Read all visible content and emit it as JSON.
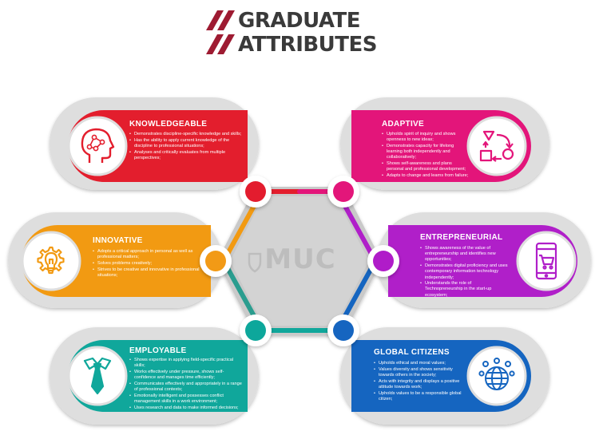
{
  "title": {
    "line1": "GRADUATE",
    "line2": "ATTRIBUTES"
  },
  "center": {
    "watermark": "MUC"
  },
  "colors": {
    "knowledgeable": "#e31e2d",
    "adaptive": "#e3157a",
    "innovative": "#f29a12",
    "entrepreneurial": "#b01fc9",
    "employable": "#10a79b",
    "global_citizens": "#1565c0"
  },
  "cards": {
    "knowledgeable": {
      "title": "KNOWLEDGEABLE",
      "icon": "head-network-icon",
      "bullets": [
        "Demonstrates discipline-specific knowledge and skills;",
        "Has the ability to apply current knowledge of the discipline to professional situations;",
        "Analyses and critically evaluates from multiple perspectives;"
      ]
    },
    "adaptive": {
      "title": "ADAPTIVE",
      "icon": "cycle-shapes-icon",
      "bullets": [
        "Upholds spirit of inquiry and shows openness to new ideas;",
        "Demonstrates capacity for lifelong learning both independently and collaboratively;",
        "Shows self-awareness and plans personal and professional development;",
        "Adapts to change and learns from failure;"
      ]
    },
    "innovative": {
      "title": "INNOVATIVE",
      "icon": "lightbulb-gear-icon",
      "bullets": [
        "Adopts a critical approach in personal as well as professional matters;",
        "Solves problems creatively;",
        "Strives to be creative and innovative in professional situations;"
      ]
    },
    "entrepreneurial": {
      "title": "ENTREPRENEURIAL",
      "icon": "phone-cart-icon",
      "bullets": [
        "Shows awareness of the value of entrepreneurship and identifies new opportunities;",
        "Demonstrates digital proficiency and uses contemporary information technology independently;",
        "Understands the role of Technopreneurship in the start-up ecosystem;"
      ]
    },
    "employable": {
      "title": "EMPLOYABLE",
      "icon": "necktie-icon",
      "bullets": [
        "Shows expertise in applying field-specific practical skills;",
        "Works effectively under pressure, shows self-confidence and manages time efficiently;",
        "Communicates effectively and appropriately in a range of professional contexts;",
        "Emotionally intelligent and possesses conflict management skills in a work environment;",
        "Uses research and data to make informed decisions;"
      ]
    },
    "global_citizens": {
      "title": "GLOBAL CITIZENS",
      "icon": "globe-people-icon",
      "bullets": [
        "Upholds ethical and moral values;",
        "Values diversity and shows sensitivity towards others in the society;",
        "Acts with integrity and displays a positive attitude towards work;",
        "Upholds values to be a responsible global citizen;"
      ]
    }
  }
}
